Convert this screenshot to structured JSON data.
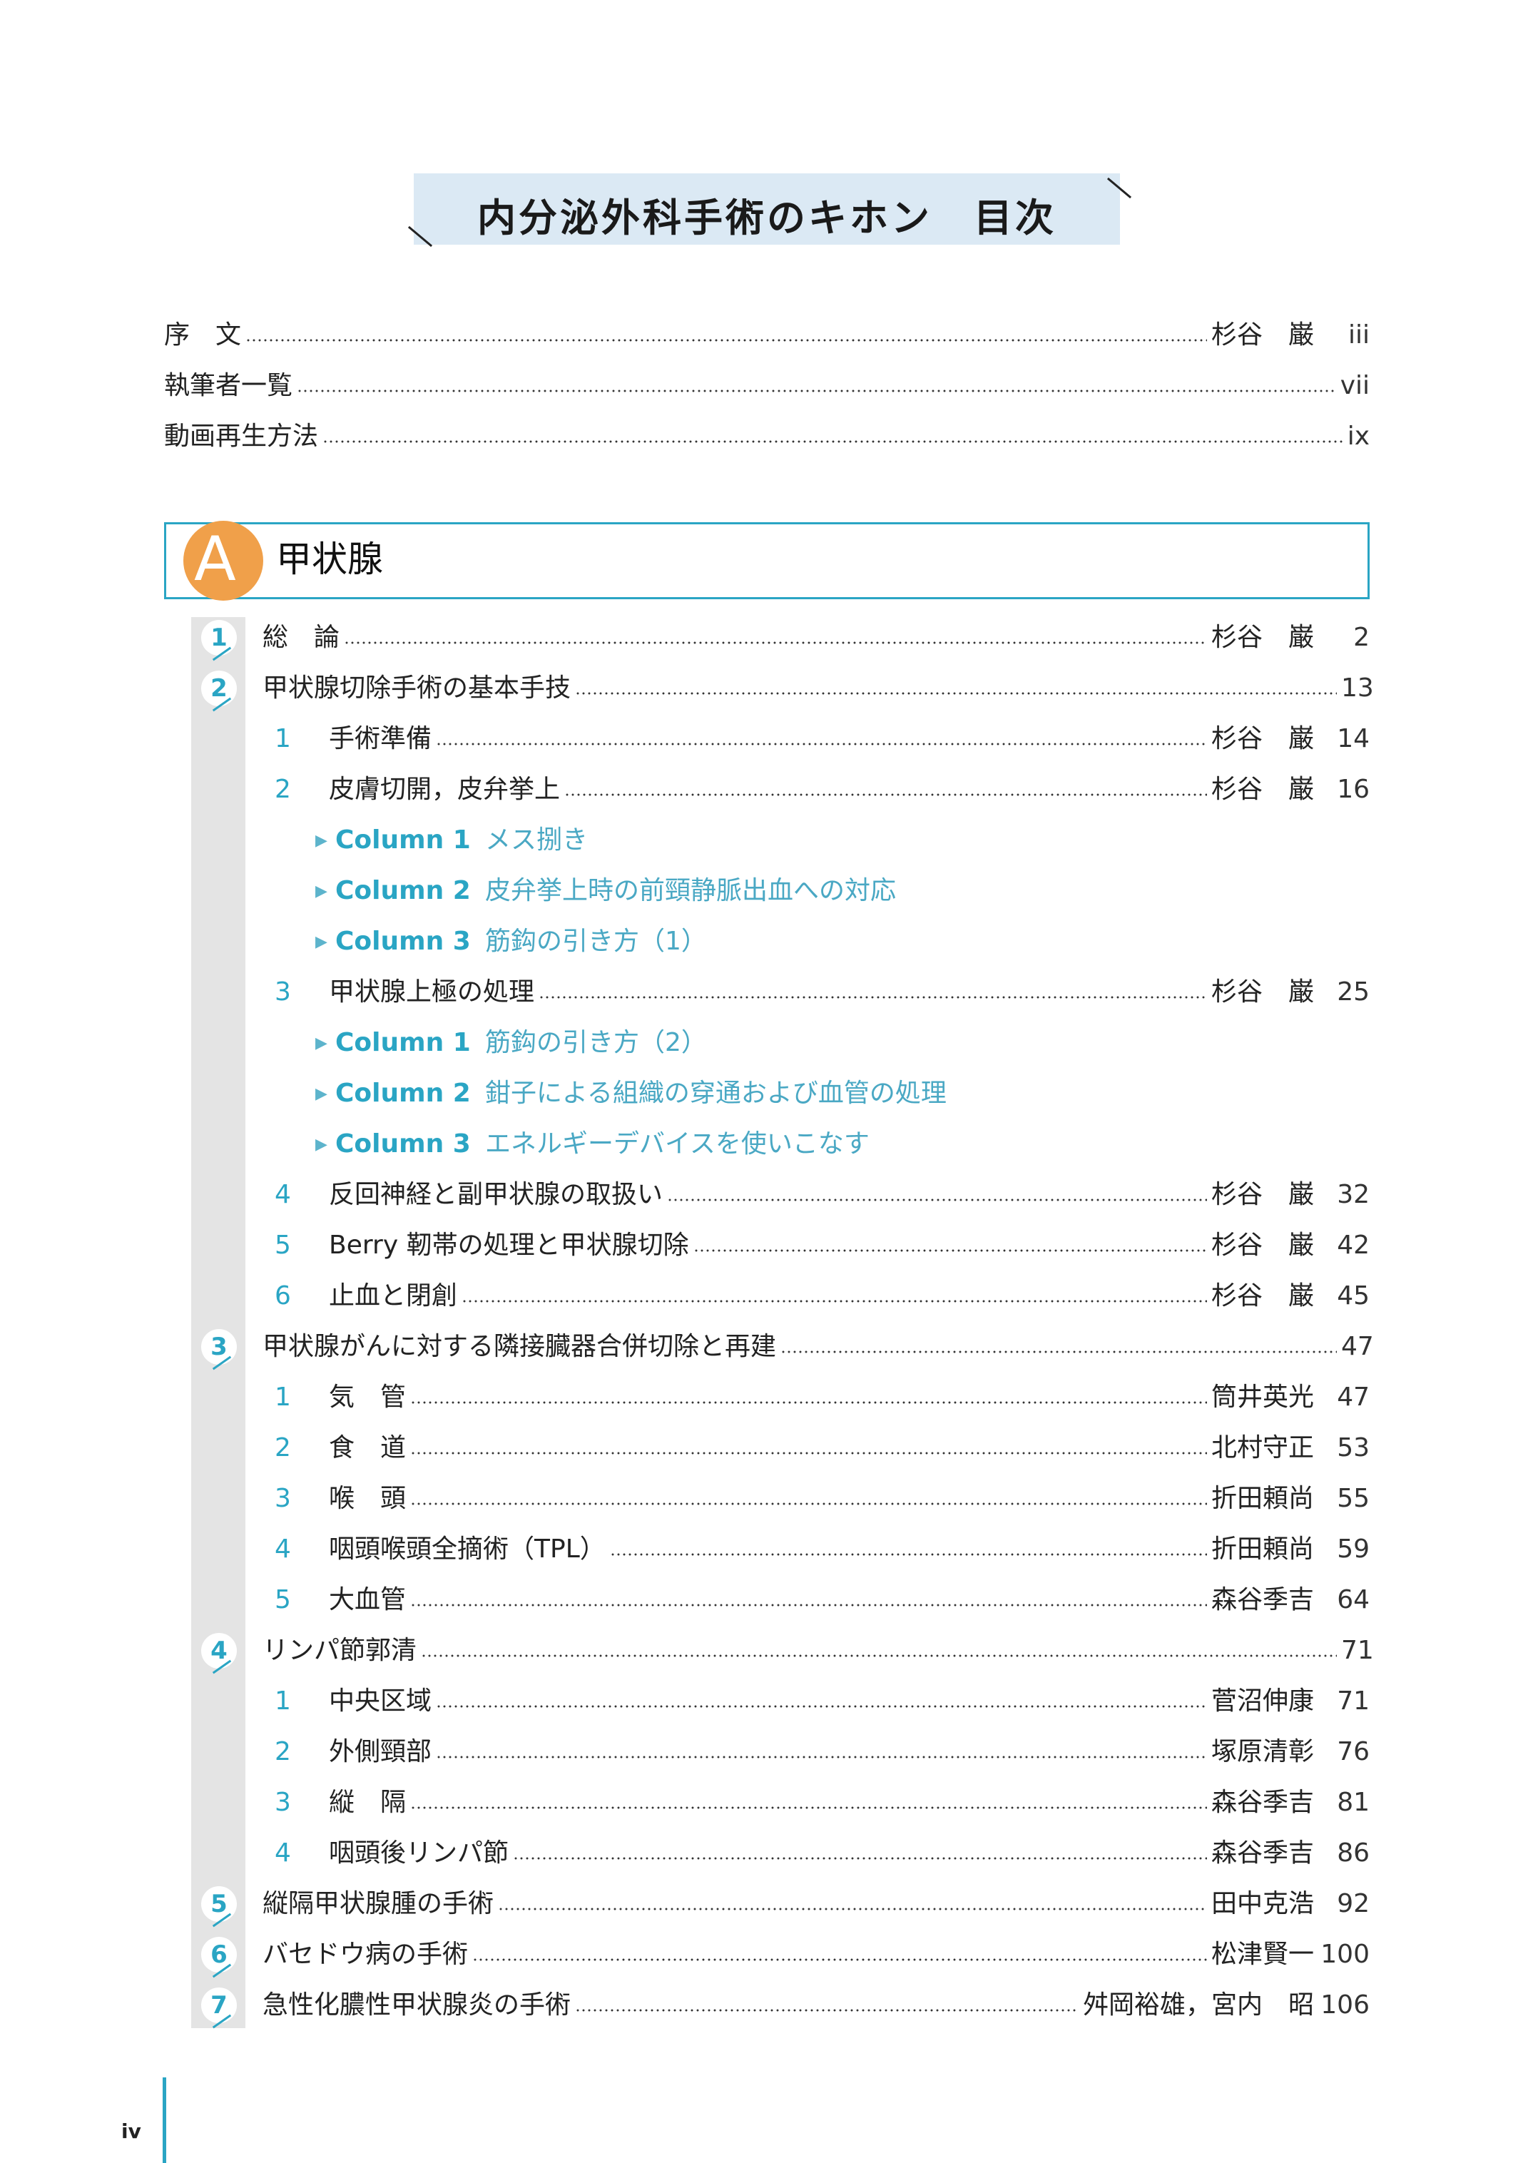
{
  "title": "内分泌外科手術のキホン　目次",
  "front": [
    {
      "label": "序　文",
      "author": "杉谷　巌",
      "page": "iii"
    },
    {
      "label": "執筆者一覧",
      "author": "",
      "page": "vii"
    },
    {
      "label": "動画再生方法",
      "author": "",
      "page": "ix"
    }
  ],
  "section": {
    "letter": "A",
    "title": "甲状腺"
  },
  "chapters": [
    {
      "num": "1",
      "label": "総　論",
      "author": "杉谷　巌",
      "page": "2"
    },
    {
      "num": "2",
      "label": "甲状腺切除手術の基本手技",
      "author": "",
      "page": "13",
      "items": [
        {
          "num": "1",
          "label": "手術準備",
          "author": "杉谷　巌",
          "page": "14"
        },
        {
          "num": "2",
          "label": "皮膚切開，皮弁挙上",
          "author": "杉谷　巌",
          "page": "16",
          "columns": [
            {
              "tag": "Column 1",
              "title": "メス捌き"
            },
            {
              "tag": "Column 2",
              "title": "皮弁挙上時の前頸静脈出血への対応"
            },
            {
              "tag": "Column 3",
              "title": "筋鈎の引き方（1）"
            }
          ]
        },
        {
          "num": "3",
          "label": "甲状腺上極の処理",
          "author": "杉谷　巌",
          "page": "25",
          "columns": [
            {
              "tag": "Column 1",
              "title": "筋鈎の引き方（2）"
            },
            {
              "tag": "Column 2",
              "title": "鉗子による組織の穿通および血管の処理"
            },
            {
              "tag": "Column 3",
              "title": "エネルギーデバイスを使いこなす"
            }
          ]
        },
        {
          "num": "4",
          "label": "反回神経と副甲状腺の取扱い",
          "author": "杉谷　巌",
          "page": "32"
        },
        {
          "num": "5",
          "label": "Berry 靭帯の処理と甲状腺切除",
          "author": "杉谷　巌",
          "page": "42"
        },
        {
          "num": "6",
          "label": "止血と閉創",
          "author": "杉谷　巌",
          "page": "45"
        }
      ]
    },
    {
      "num": "3",
      "label": "甲状腺がんに対する隣接臓器合併切除と再建",
      "author": "",
      "page": "47",
      "items": [
        {
          "num": "1",
          "label": "気　管",
          "author": "筒井英光",
          "page": "47"
        },
        {
          "num": "2",
          "label": "食　道",
          "author": "北村守正",
          "page": "53"
        },
        {
          "num": "3",
          "label": "喉　頭",
          "author": "折田頼尚",
          "page": "55"
        },
        {
          "num": "4",
          "label": "咽頭喉頭全摘術（TPL）",
          "author": "折田頼尚",
          "page": "59"
        },
        {
          "num": "5",
          "label": "大血管",
          "author": "森谷季吉",
          "page": "64"
        }
      ]
    },
    {
      "num": "4",
      "label": "リンパ節郭清",
      "author": "",
      "page": "71",
      "items": [
        {
          "num": "1",
          "label": "中央区域",
          "author": "菅沼伸康",
          "page": "71"
        },
        {
          "num": "2",
          "label": "外側頸部",
          "author": "塚原清彰",
          "page": "76"
        },
        {
          "num": "3",
          "label": "縦　隔",
          "author": "森谷季吉",
          "page": "81"
        },
        {
          "num": "4",
          "label": "咽頭後リンパ節",
          "author": "森谷季吉",
          "page": "86"
        }
      ]
    },
    {
      "num": "5",
      "label": "縦隔甲状腺腫の手術",
      "author": "田中克浩",
      "page": "92"
    },
    {
      "num": "6",
      "label": "バセドウ病の手術",
      "author": "松津賢一",
      "page": "100"
    },
    {
      "num": "7",
      "label": "急性化膿性甲状腺炎の手術",
      "author": "舛岡裕雄，宮内　昭",
      "page": "106"
    }
  ],
  "footer": {
    "page_number": "iv"
  }
}
